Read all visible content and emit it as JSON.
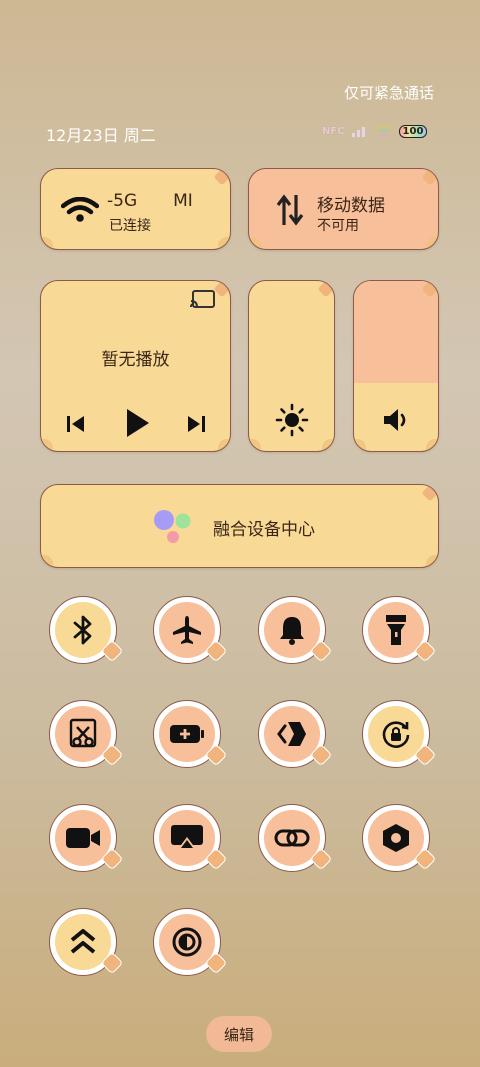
{
  "status": {
    "emergency_text": "仅可紧急通话",
    "date_text": "12月23日 周二",
    "nfc_label": "NFC",
    "battery_level": "100"
  },
  "tiles": {
    "wifi": {
      "title": "5G",
      "title_prefix": "-",
      "title_suffix": "MI",
      "subtitle": "已连接"
    },
    "mobile_data": {
      "title": "移动数据",
      "subtitle": "不可用"
    },
    "media": {
      "title": "暂无播放"
    },
    "brightness": {
      "level": 0.0
    },
    "volume": {
      "level": 0.6
    },
    "device_center": {
      "title": "融合设备中心"
    }
  },
  "toggles": [
    {
      "icon": "bluetooth-icon",
      "style": "yellow"
    },
    {
      "icon": "airplane-icon",
      "style": "peach"
    },
    {
      "icon": "bell-icon",
      "style": "peach"
    },
    {
      "icon": "flashlight-icon",
      "style": "peach"
    },
    {
      "icon": "screenshot-scissors-icon",
      "style": "peach"
    },
    {
      "icon": "battery-saver-icon",
      "style": "peach"
    },
    {
      "icon": "nearby-share-icon",
      "style": "peach"
    },
    {
      "icon": "rotation-lock-icon",
      "style": "yellow"
    },
    {
      "icon": "screen-record-icon",
      "style": "peach"
    },
    {
      "icon": "screen-cast-icon",
      "style": "peach"
    },
    {
      "icon": "link-icon",
      "style": "peach"
    },
    {
      "icon": "settings-hex-icon",
      "style": "peach"
    },
    {
      "icon": "performance-mode-icon",
      "style": "yellow"
    },
    {
      "icon": "dark-mode-icon",
      "style": "peach"
    }
  ],
  "edit_button": {
    "label": "编辑"
  },
  "colors": {
    "tile_yellow": "#f8d995",
    "tile_peach": "#f7bf9a",
    "border": "#8c5a49"
  }
}
